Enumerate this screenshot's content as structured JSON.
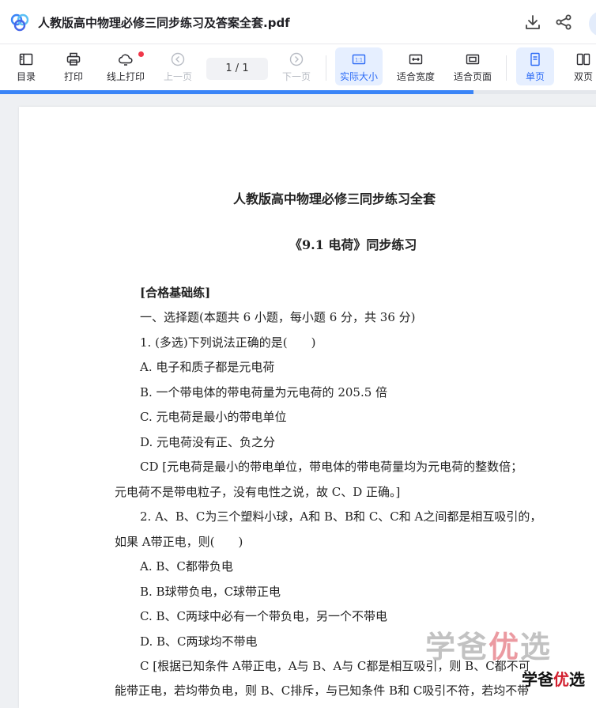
{
  "header": {
    "title": "人教版高中物理必修三同步练习及答案全套.pdf"
  },
  "toolbar": {
    "toc": "目录",
    "print": "打印",
    "online_print": "线上打印",
    "prev": "上一页",
    "page_indicator": "1  / 1",
    "next": "下一页",
    "actual_size": "实际大小",
    "fit_width": "适合宽度",
    "fit_page": "适合页面",
    "single_page": "单页",
    "double_page": "双页"
  },
  "progress": {
    "fraction": 0.795
  },
  "document": {
    "main_title": "人教版高中物理必修三同步练习全套",
    "section_title": "《9.1 电荷》同步练习",
    "lines": [
      "[合格基础练]",
      "一、选择题(本题共 6 小题，每小题 6 分，共 36 分)",
      "1. (多选)下列说法正确的是(　　)",
      "A. 电子和质子都是元电荷",
      "B. 一个带电体的带电荷量为元电荷的 205.5 倍",
      "C. 元电荷是最小的带电单位",
      "D. 元电荷没有正、负之分",
      "CD  [元电荷是最小的带电单位，带电体的带电荷量均为元电荷的整数倍；",
      "元电荷不是带电粒子，没有电性之说，故 C、D 正确。]",
      "2. A、B、C为三个塑料小球，A和 B、B和 C、C和 A之间都是相互吸引的，",
      "如果 A带正电，则(　　)",
      "A. B、C都带负电",
      "B. B球带负电，C球带正电",
      "C. B、C两球中必有一个带负电，另一个不带电",
      "D. B、C两球均不带电",
      "C  [根据已知条件 A带正电，A与 B、A与 C都是相互吸引，则 B、C都不可",
      "能带正电，若均带负电，则 B、C排斥，与已知条件 B和 C吸引不符，若均不带"
    ]
  },
  "watermark": {
    "big_a": "学爸",
    "big_b": "优",
    "big_c": "选",
    "small_a": "学爸",
    "small_b": "优",
    "small_c": "选"
  },
  "colors": {
    "accent": "#2e6cf6",
    "progress": "#3a84f7",
    "badge": "#f0384a"
  }
}
